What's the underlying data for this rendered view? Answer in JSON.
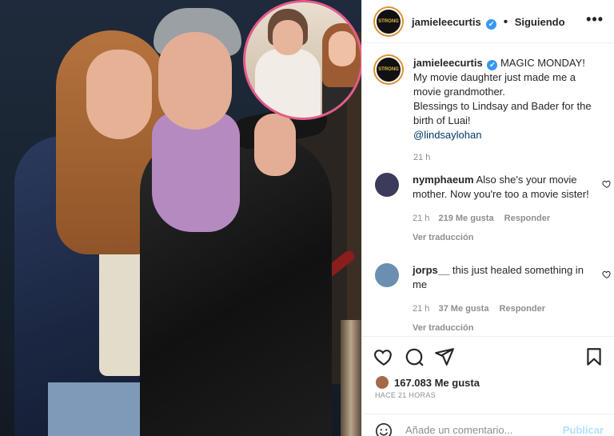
{
  "post": {
    "username": "jamieleecurtis",
    "verified_mark": "✔",
    "follow_status": "Siguiendo",
    "more_icon": "more-options-icon",
    "avatar_text": "STRONG",
    "caption_lines": [
      "MAGIC MONDAY!",
      "My movie daughter just made me a",
      "movie grandmother.",
      "Blessings to Lindsay and Bader for the",
      "birth of Luai!"
    ],
    "mention": "@lindsaylohan",
    "caption_time": "21 h"
  },
  "comments": [
    {
      "username": "nymphaeum",
      "text": "Also she's your movie mother. Now you're too a movie sister!",
      "time": "21 h",
      "likes": "219 Me gusta",
      "reply": "Responder",
      "translate": "Ver traducción",
      "avatar_color": "#3b3b5c"
    },
    {
      "username": "jorps__",
      "text": "this just healed something in me",
      "time": "21 h",
      "likes": "37 Me gusta",
      "reply": "Responder",
      "translate": "Ver traducción",
      "avatar_color": "#6a8fb0"
    }
  ],
  "actions": {
    "like_icon": "heart-icon",
    "comment_icon": "comment-icon",
    "share_icon": "share-icon",
    "save_icon": "bookmark-icon",
    "likes_count": "167.083 Me gusta",
    "posted_ago": "HACE 21 HORAS"
  },
  "add_comment": {
    "placeholder": "Añade un comentario...",
    "publish_label": "Publicar",
    "emoji_icon": "emoji-icon"
  },
  "colors": {
    "accent_link": "#00376b",
    "verified": "#3897f0",
    "publish_disabled": "#b2dffc",
    "story_ring": "#e08f2f"
  }
}
